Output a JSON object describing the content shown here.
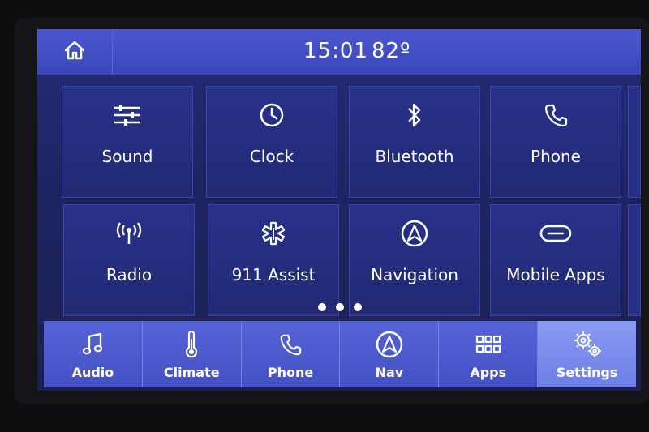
{
  "status": {
    "time": "15:01",
    "temperature": "82º"
  },
  "home": {
    "icon": "home-icon"
  },
  "tiles": [
    {
      "label": "Sound",
      "icon": "equalizer-icon"
    },
    {
      "label": "Clock",
      "icon": "clock-icon"
    },
    {
      "label": "Bluetooth",
      "icon": "bluetooth-icon"
    },
    {
      "label": "Phone",
      "icon": "phone-icon"
    },
    {
      "label": "Radio",
      "icon": "antenna-icon"
    },
    {
      "label": "911 Assist",
      "icon": "star-of-life-icon"
    },
    {
      "label": "Navigation",
      "icon": "navigation-arrow-icon"
    },
    {
      "label": "Mobile Apps",
      "icon": "mobile-apps-icon"
    }
  ],
  "pager": {
    "pages": 3
  },
  "bottom_nav": [
    {
      "label": "Audio",
      "icon": "music-note-icon",
      "active": false
    },
    {
      "label": "Climate",
      "icon": "thermometer-icon",
      "active": false
    },
    {
      "label": "Phone",
      "icon": "phone-icon",
      "active": false
    },
    {
      "label": "Nav",
      "icon": "navigation-arrow-icon",
      "active": false
    },
    {
      "label": "Apps",
      "icon": "app-grid-icon",
      "active": false
    },
    {
      "label": "Settings",
      "icon": "gears-icon",
      "active": true
    }
  ],
  "colors": {
    "status_bar": "#3b46b8",
    "screen_bg": "#1e2462",
    "bottom_bar": "#4451c4",
    "active_item": "#7a8bee"
  }
}
